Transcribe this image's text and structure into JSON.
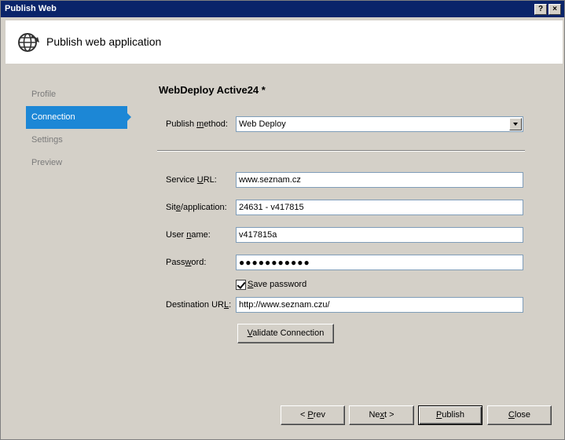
{
  "window": {
    "title": "Publish Web",
    "help_glyph": "?",
    "close_glyph": "×"
  },
  "header": {
    "title": "Publish web application",
    "icon": "globe-publish-icon"
  },
  "nav": {
    "items": [
      {
        "label": "Profile",
        "active": false
      },
      {
        "label": "Connection",
        "active": true
      },
      {
        "label": "Settings",
        "active": false
      },
      {
        "label": "Preview",
        "active": false
      }
    ]
  },
  "form": {
    "profile_title": "WebDeploy Active24  *",
    "publish_method": {
      "label_pre": "Publish ",
      "label_ul": "m",
      "label_post": "ethod:",
      "value": "Web Deploy"
    },
    "service_url": {
      "label_pre": "Service ",
      "label_ul": "U",
      "label_post": "RL:",
      "value": "www.seznam.cz"
    },
    "site_app": {
      "label_pre": "Sit",
      "label_ul": "e",
      "label_post": "/application:",
      "value": "24631 - v417815"
    },
    "user_name": {
      "label_pre": "User ",
      "label_ul": "n",
      "label_post": "ame:",
      "value": "v417815a"
    },
    "password": {
      "label_pre": "Pass",
      "label_ul": "w",
      "label_post": "ord:",
      "value": "●●●●●●●●●●●"
    },
    "save_password": {
      "label_pre": "",
      "label_ul": "S",
      "label_post": "ave password",
      "checked": true
    },
    "destination_url": {
      "label_pre": "Destination UR",
      "label_ul": "L",
      "label_post": ":",
      "value": "http://www.seznam.czu/"
    },
    "validate": {
      "label_pre": "",
      "label_ul": "V",
      "label_post": "alidate Connection"
    }
  },
  "footer": {
    "prev": {
      "label_pre": "< ",
      "label_ul": "P",
      "label_post": "rev"
    },
    "next": {
      "label_pre": "Ne",
      "label_ul": "x",
      "label_post": "t >"
    },
    "publish": {
      "label_pre": "",
      "label_ul": "P",
      "label_post": "ublish"
    },
    "close": {
      "label_pre": "",
      "label_ul": "C",
      "label_post": "lose"
    }
  },
  "colors": {
    "titlebar": "#0a246a",
    "nav_active": "#1c87d6",
    "dialog_bg": "#d4d0c8"
  }
}
